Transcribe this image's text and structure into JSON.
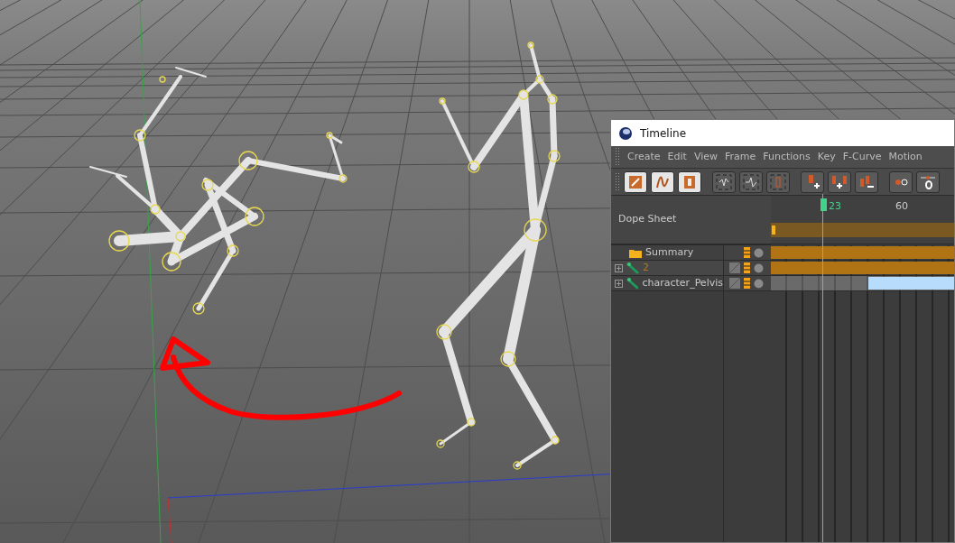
{
  "timeline": {
    "title": "Timeline",
    "menu": [
      "Create",
      "Edit",
      "View",
      "Frame",
      "Functions",
      "Key",
      "F-Curve",
      "Motion"
    ],
    "panel_title": "Dope Sheet",
    "current_frame": "23",
    "ruler_labels": [
      "60"
    ],
    "tracks": [
      {
        "kind": "folder",
        "label": "Summary",
        "expandable": false,
        "highlighted": false,
        "color": "#b07414"
      },
      {
        "kind": "object",
        "label": "2",
        "expandable": true,
        "highlighted": true,
        "color": "#b07414"
      },
      {
        "kind": "object",
        "label": "character_Pelvis",
        "expandable": true,
        "highlighted": false,
        "color": "#b8dcfb"
      }
    ]
  }
}
